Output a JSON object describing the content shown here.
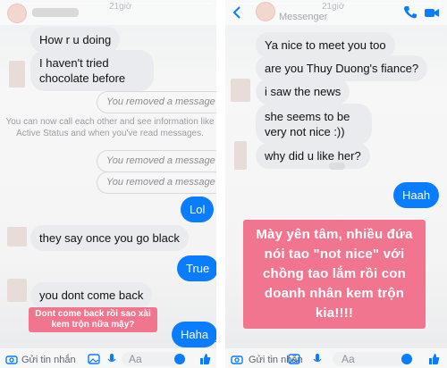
{
  "left": {
    "story_time": "21giờ",
    "messages": {
      "m1": "How r u doing",
      "m2": "I haven't tried chocolate before",
      "removed1": "You removed a message",
      "system": "You can now call each other and see information like Active Status and when you've read messages.",
      "removed2": "You removed a message",
      "removed3": "You removed a message",
      "me1": "Lol",
      "m3": "they say once you go black",
      "me2": "True",
      "m4": "you dont come back",
      "me3": "Haha"
    },
    "caption": "Dont come back rồi sao xài kem trộn nữa mậy?",
    "composer": {
      "send_label": "Gửi tin nhắn",
      "aa": "Aa"
    }
  },
  "right": {
    "story_time": "21giờ",
    "header_sub": "Messenger",
    "messages": {
      "m1": "Ya nice to meet you too",
      "m2": "are you Thuy Duong's fiance?",
      "m3": "i saw the news",
      "m4": "she seems to be very not nice :))",
      "m5": "why did u like her?",
      "me1": "Haah"
    },
    "caption": "Mày yên tâm, nhiều đứa nói tao \"not nice\" với chồng tao lắm rồi con doanh nhân kem trộn kia!!!!",
    "composer": {
      "send_label": "Gửi tin nhắn",
      "aa": "Aa"
    }
  },
  "colors": {
    "messenger_blue": "#0a7cff",
    "caption_pink": "#f2758f",
    "bubble_gray": "#e9ebee"
  },
  "icons": [
    "back-arrow-icon",
    "call-icon",
    "video-call-icon",
    "camera-icon",
    "image-icon",
    "mic-icon",
    "emoji-icon",
    "like-icon"
  ]
}
